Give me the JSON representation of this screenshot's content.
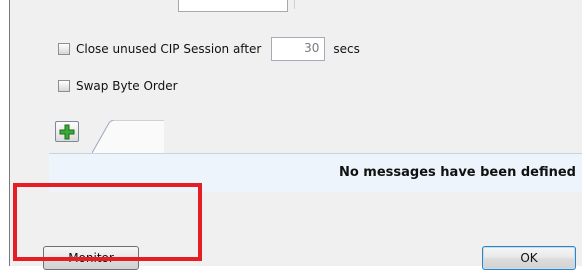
{
  "settings": {
    "close_session_label": "Close unused CIP Session after",
    "close_session_value": "30",
    "close_session_unit": "secs",
    "swap_byte_order_label": "Swap Byte Order"
  },
  "messages": {
    "empty_text": "No messages have been defined"
  },
  "footer": {
    "monitor_label": "Monitor",
    "ok_label": "OK"
  },
  "colors": {
    "highlight": "#e51e25",
    "add_icon": "#3aa935"
  },
  "icons": {
    "add": "green-plus-icon"
  }
}
